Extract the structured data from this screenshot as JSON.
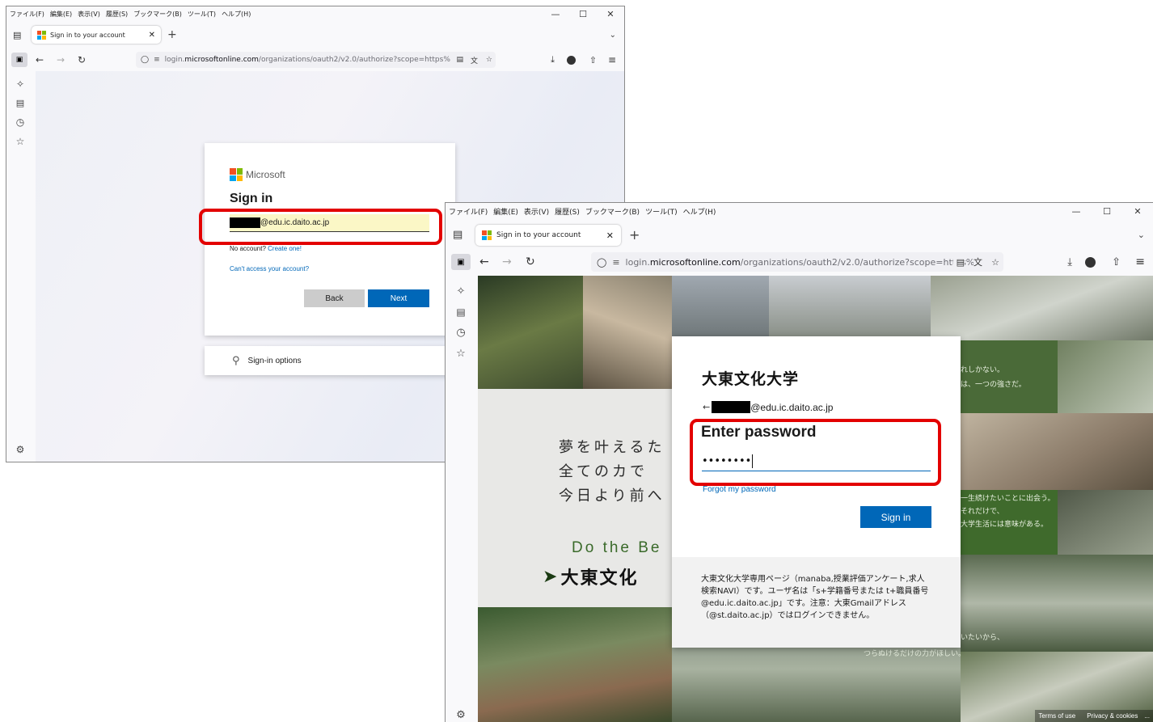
{
  "browser": {
    "menu": [
      "ファイル(F)",
      "編集(E)",
      "表示(V)",
      "履歴(S)",
      "ブックマーク(B)",
      "ツール(T)",
      "ヘルプ(H)"
    ],
    "tab_title": "Sign in to your account",
    "url_prefix": "login.",
    "url_domain": "microsoftonline.com",
    "url_path": "/organizations/oauth2/v2.0/authorize?scope=https%"
  },
  "window1": {
    "brand": "Microsoft",
    "heading": "Sign in",
    "email_suffix": "@edu.ic.daito.ac.jp",
    "no_account": "No account?",
    "create_one": "Create one!",
    "cant_access": "Can't access your account?",
    "back": "Back",
    "next": "Next",
    "signin_options": "Sign-in options"
  },
  "window2": {
    "brand": "大東文化大学",
    "email_suffix": "@edu.ic.daito.ac.jp",
    "heading": "Enter password",
    "password_mask": "••••••••",
    "forgot": "Forgot my password",
    "signin": "Sign in",
    "notice": "大東文化大学専用ページ（manaba,授業評価アンケート,求人検索NAVI）です。ユーザ名は「s+学籍番号または t+職員番号@edu.ic.daito.ac.jp」です。注意：大東Gmailアドレス（@st.daito.ac.jp）ではログインできません。",
    "bg_text": [
      "夢を叶えるた",
      "全てのカで",
      "今日より前へ"
    ],
    "bg_en": "Do the Be",
    "bg_logo": "大東文化",
    "bg_right": [
      "れしかない。",
      "は、一つの強さだ。",
      "一生続けたいことに出会う。",
      "それだけで、",
      "大学生活には意味がある。",
      "いたいから、",
      "つらぬけるだけの力がほしい。"
    ],
    "footer_terms": "Terms of use",
    "footer_privacy": "Privacy & cookies",
    "footer_more": "..."
  },
  "colors": {
    "ms_blue": "#0067b8",
    "highlight": "#e30000"
  }
}
